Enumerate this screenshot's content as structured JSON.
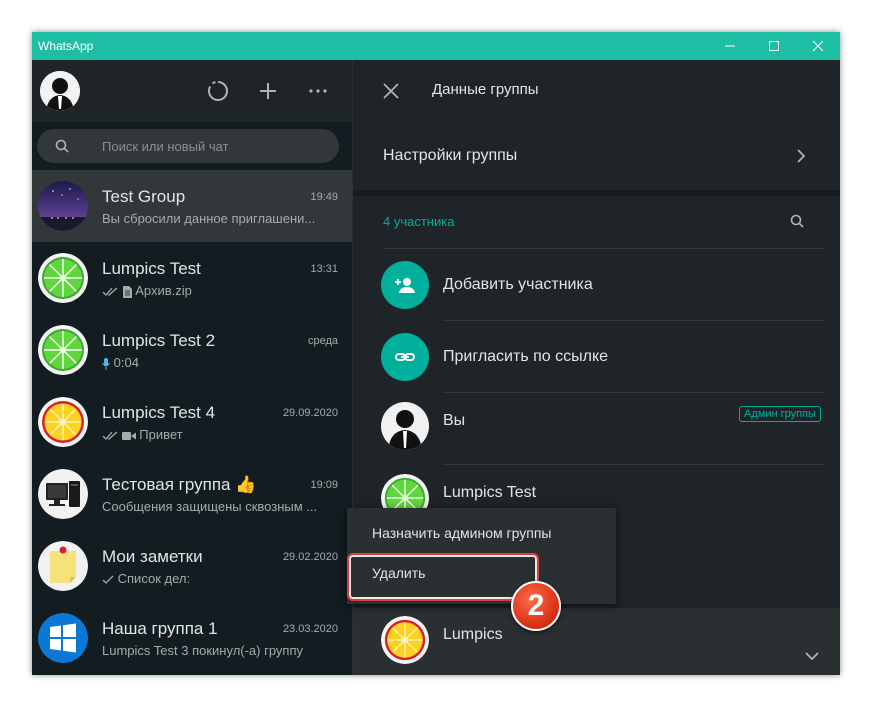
{
  "window": {
    "app_title": "WhatsApp"
  },
  "sidebar": {
    "search_placeholder": "Поиск или новый чат",
    "chats": [
      {
        "name": "Test Group",
        "time": "19:49",
        "preview": "Вы сбросили данное приглашени...",
        "avatar": "night-sky-avatar",
        "active": true
      },
      {
        "name": "Lumpics Test",
        "time": "13:31",
        "preview": "Архив.zip",
        "status": "read-double-check-icon",
        "preview_icon": "document-icon",
        "avatar": "green-lime-avatar"
      },
      {
        "name": "Lumpics Test 2",
        "time": "среда",
        "preview": "0:04",
        "preview_icon": "microphone-icon",
        "avatar": "green-lime-avatar"
      },
      {
        "name": "Lumpics Test 4",
        "time": "29.09.2020",
        "preview": "Привет",
        "status": "read-double-check-icon",
        "preview_icon": "video-icon",
        "avatar": "yellow-lemon-avatar"
      },
      {
        "name": "Тестовая группа",
        "name_emoji": "👍",
        "time": "19:09",
        "preview": "Сообщения защищены сквозным ...",
        "avatar": "computer-avatar"
      },
      {
        "name": "Мои заметки",
        "time": "29.02.2020",
        "preview": "Список дел:",
        "status": "single-check-icon",
        "avatar": "sticky-note-avatar"
      },
      {
        "name": "Наша группа 1",
        "time": "23.03.2020",
        "preview": "Lumpics Test 3 покинул(-а) группу",
        "avatar": "windows-logo-avatar"
      }
    ]
  },
  "panel": {
    "title": "Данные группы",
    "group_settings": "Настройки группы",
    "members_label": "4 участника",
    "add_member": "Добавить участника",
    "invite_link": "Пригласить по ссылке",
    "members": [
      {
        "name": "Вы",
        "badge": "Админ группы",
        "avatar": "man-silhouette-avatar"
      },
      {
        "name": "Lumpics Test",
        "avatar": "green-lime-avatar"
      },
      {
        "name": "Lumpics",
        "avatar": "yellow-lemon-avatar"
      }
    ]
  },
  "context_menu": {
    "items": [
      "Назначить админом группы",
      "Удалить"
    ],
    "highlighted_item": "Удалить"
  },
  "annotation": {
    "step": "2"
  },
  "colors": {
    "titlebar": "#1ebea5",
    "accent": "#00af9c",
    "background": "#131c21",
    "header": "#1e2428",
    "highlight": "#e23a3a"
  }
}
